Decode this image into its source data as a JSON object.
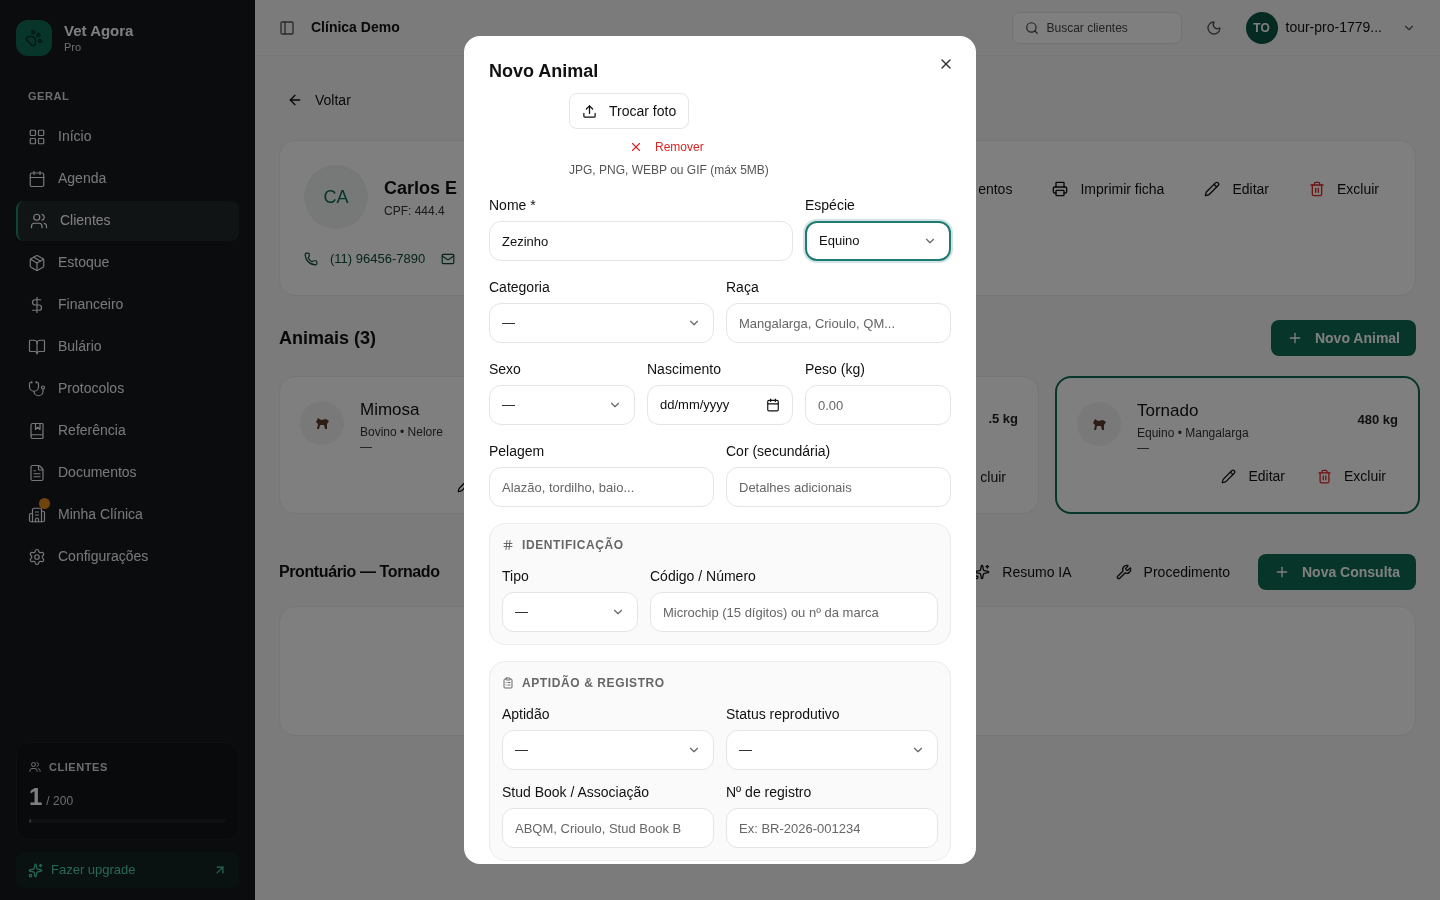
{
  "sidebar": {
    "brand": {
      "name": "Vet Agora",
      "plan": "Pro"
    },
    "section_label": "GERAL",
    "items": [
      {
        "label": "Início",
        "selected": false,
        "badge": false
      },
      {
        "label": "Agenda",
        "selected": false,
        "badge": false
      },
      {
        "label": "Clientes",
        "selected": true,
        "badge": false
      },
      {
        "label": "Estoque",
        "selected": false,
        "badge": false
      },
      {
        "label": "Financeiro",
        "selected": false,
        "badge": false
      },
      {
        "label": "Bulário",
        "selected": false,
        "badge": false
      },
      {
        "label": "Protocolos",
        "selected": false,
        "badge": false
      },
      {
        "label": "Referência",
        "selected": false,
        "badge": false
      },
      {
        "label": "Documentos",
        "selected": false,
        "badge": false
      },
      {
        "label": "Minha Clínica",
        "selected": false,
        "badge": true
      },
      {
        "label": "Configurações",
        "selected": false,
        "badge": false
      }
    ],
    "usage": {
      "label": "CLIENTES",
      "count": "1",
      "limit": "/ 200",
      "level": 0.005
    },
    "upgrade_button": "Fazer upgrade"
  },
  "topbar": {
    "clinic": "Clínica Demo",
    "search_placeholder": "Buscar clientes",
    "user": {
      "initials": "TO",
      "name": "tour-pro-1779..."
    }
  },
  "main": {
    "back": "Voltar",
    "client": {
      "initials": "CA",
      "name": "Carlos E",
      "cpf": "CPF: 444.4",
      "phone": "(11) 96456-7890"
    },
    "client_actions": [
      {
        "kind": "plain",
        "label": "entos"
      },
      {
        "kind": "print",
        "label": "Imprimir ficha"
      },
      {
        "kind": "edit",
        "label": "Editar"
      },
      {
        "kind": "delete",
        "label": "Excluir"
      }
    ],
    "animals_title": "Animais (3)",
    "new_animal_button": "Novo Animal",
    "animals": [
      {
        "name": "Mimosa",
        "subtitle": "Bovino • Nelore",
        "note": "—",
        "selected": false,
        "edit_icon": true
      },
      {
        "weight": ".5 kg",
        "delete_label": "cluir",
        "selected": false
      },
      {
        "name": "Tornado",
        "subtitle": "Equino • Mangalarga",
        "note": "—",
        "weight": "480 kg",
        "edit_label": "Editar",
        "delete_label": "Excluir",
        "selected": true
      }
    ],
    "record_title": "Prontuário — Tornado",
    "record_actions": [
      {
        "kind": "ai",
        "label": "Resumo IA"
      },
      {
        "kind": "procedure",
        "label": "Procedimento"
      },
      {
        "kind": "primary",
        "label": "Nova Consulta"
      }
    ]
  },
  "modal": {
    "title": "Novo Animal",
    "photo_button": "Trocar foto",
    "remove_button": "Remover",
    "hint": "JPG, PNG, WEBP ou GIF (máx 5MB)",
    "rows": [
      [
        {
          "label": "Nome *",
          "kind": "input",
          "value": "Zezinho"
        },
        {
          "label": "Espécie",
          "kind": "select",
          "value": "Equino",
          "focused": true
        }
      ],
      [
        {
          "label": "Categoria",
          "kind": "select",
          "value": "—"
        },
        {
          "label": "Raça",
          "kind": "input",
          "placeholder": "Mangalarga, Crioulo, QM..."
        }
      ],
      [
        {
          "label": "Sexo",
          "kind": "select",
          "value": "—"
        },
        {
          "label": "Nascimento",
          "kind": "date",
          "value": "dd/mm/yyyy"
        },
        {
          "label": "Peso (kg)",
          "kind": "input",
          "placeholder": "0.00"
        }
      ],
      [
        {
          "label": "Pelagem",
          "kind": "input",
          "placeholder": "Alazão, tordilho, baio..."
        },
        {
          "label": "Cor (secundária)",
          "kind": "input",
          "placeholder": "Detalhes adicionais"
        }
      ]
    ],
    "sections": [
      {
        "kind": "id",
        "title": "IDENTIFICAÇÃO",
        "rows": [
          [
            {
              "label": "Tipo",
              "kind": "select",
              "value": "—"
            },
            {
              "label": "Código / Número",
              "kind": "input",
              "placeholder": "Microchip (15 dígitos) ou nº da marca"
            }
          ]
        ]
      },
      {
        "kind": "registry",
        "title": "APTIDÃO & REGISTRO",
        "rows": [
          [
            {
              "label": "Aptidão",
              "kind": "select",
              "value": "—"
            },
            {
              "label": "Status reprodutivo",
              "kind": "select",
              "value": "—"
            }
          ],
          [
            {
              "label": "Stud Book / Associação",
              "kind": "input",
              "placeholder": "ABQM, Crioulo, Stud Book B"
            },
            {
              "label": "Nº de registro",
              "kind": "input",
              "placeholder": "Ex: BR-2026-001234"
            }
          ]
        ]
      }
    ]
  }
}
